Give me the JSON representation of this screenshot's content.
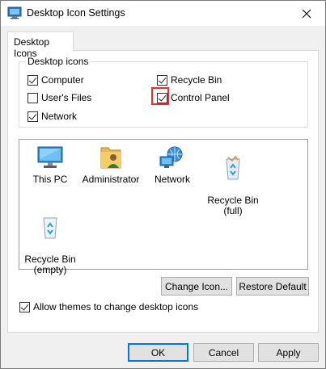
{
  "window": {
    "title": "Desktop Icon Settings"
  },
  "tabs": [
    {
      "label": "Desktop Icons"
    }
  ],
  "desktop_icons_group": {
    "legend": "Desktop icons",
    "checkboxes": [
      {
        "label": "Computer",
        "checked": true
      },
      {
        "label": "Recycle Bin",
        "checked": true
      },
      {
        "label": "User's Files",
        "checked": false
      },
      {
        "label": "Control Panel",
        "checked": true
      },
      {
        "label": "Network",
        "checked": true
      }
    ]
  },
  "icon_list": [
    {
      "label": "This PC",
      "icon": "monitor-icon"
    },
    {
      "label": "Administrator",
      "icon": "user-folder-icon"
    },
    {
      "label": "Network",
      "icon": "network-icon"
    },
    {
      "label": "Recycle Bin\n(full)",
      "icon": "recycle-bin-full-icon"
    },
    {
      "label": "Recycle Bin\n(empty)",
      "icon": "recycle-bin-empty-icon"
    }
  ],
  "buttons": {
    "change_icon": "Change Icon...",
    "restore_default": "Restore Default",
    "ok": "OK",
    "cancel": "Cancel",
    "apply": "Apply"
  },
  "allow_themes": {
    "label": "Allow themes to change desktop icons",
    "checked": true
  },
  "colors": {
    "highlight": "#e03131",
    "accent": "#0078d7"
  }
}
